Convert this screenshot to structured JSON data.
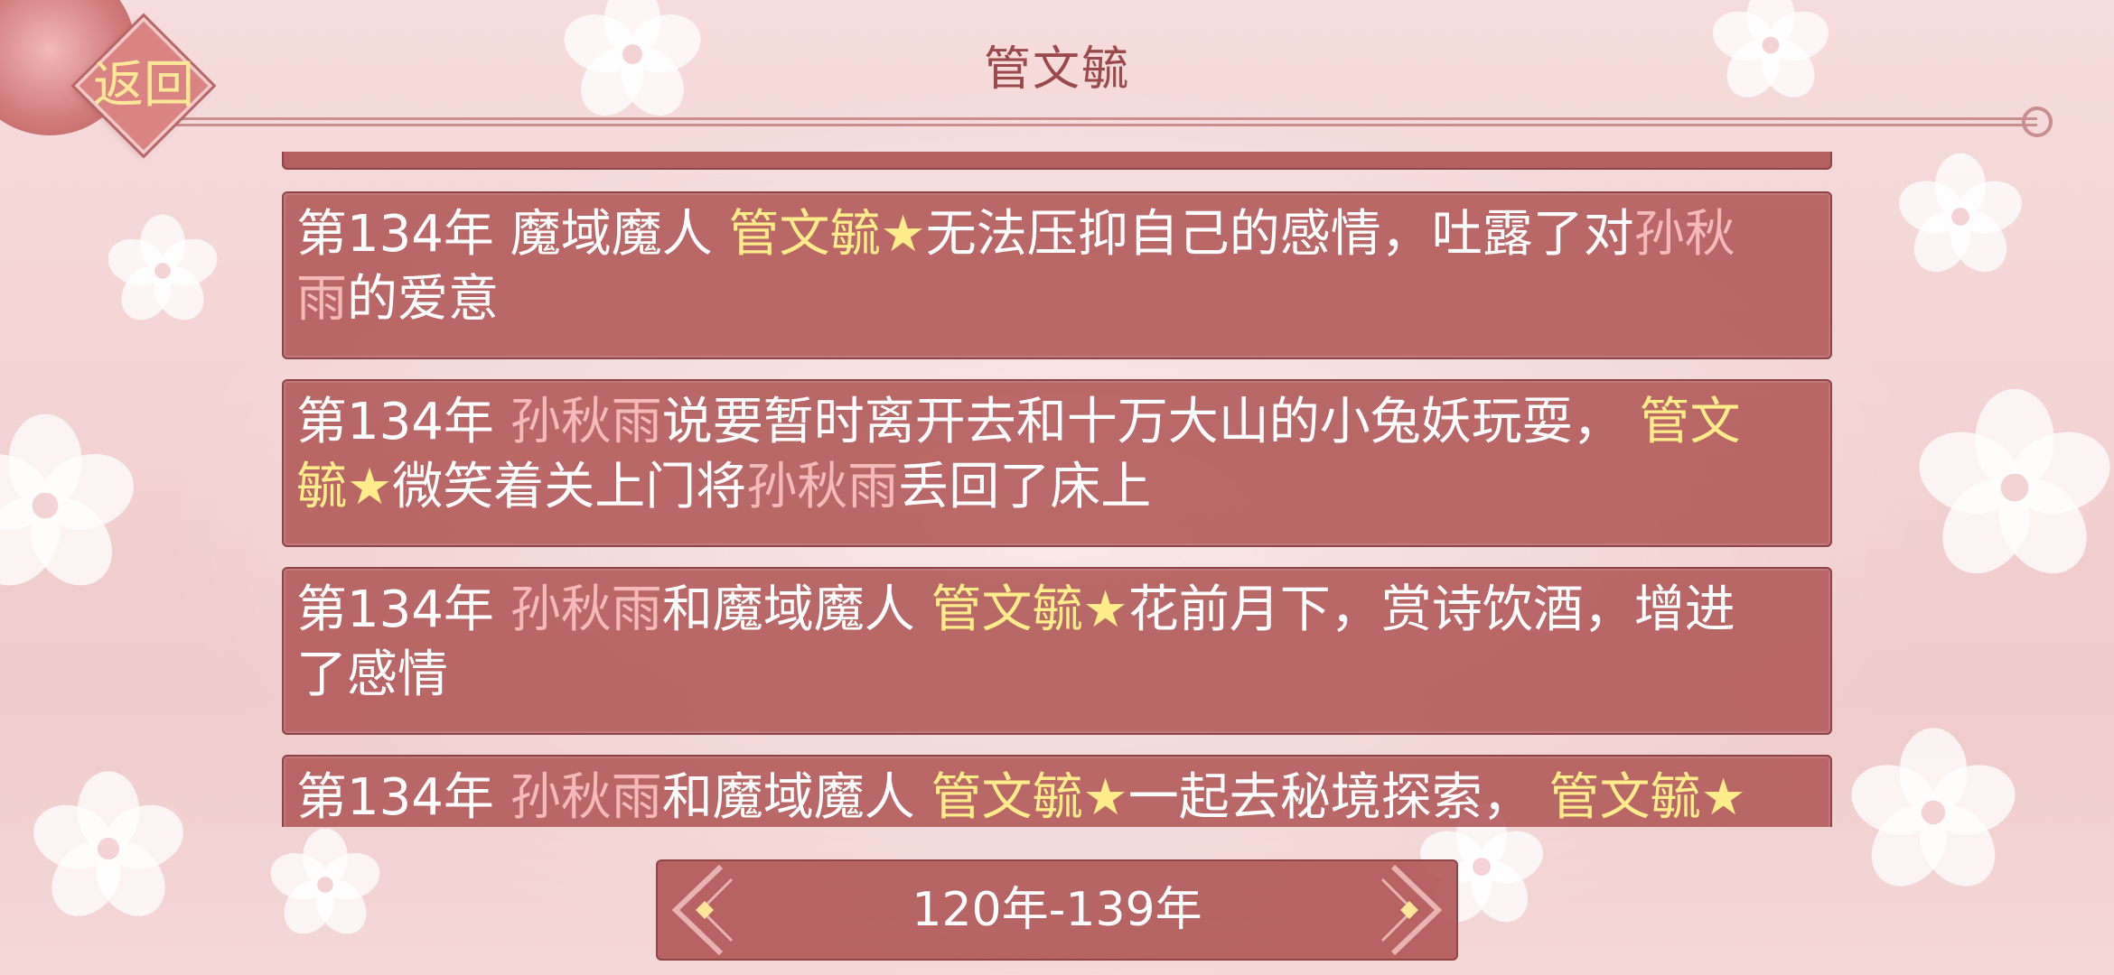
{
  "header": {
    "title": "管文毓",
    "back_label": "返回"
  },
  "icons": {
    "back": "back-button-diamond",
    "prev": "chevron-left-ornament-icon",
    "next": "chevron-right-ornament-icon",
    "star": "★"
  },
  "colors": {
    "card_bg": "#b05656",
    "highlight_main": "#ffec8a",
    "highlight_other": "#f4b9b9",
    "title": "#9a4a4a"
  },
  "entries": [
    {
      "segments": [
        {
          "text": "第134年 魔域魔人 ",
          "style": "plain"
        },
        {
          "text": "管文毓★",
          "style": "main"
        },
        {
          "text": "无法压抑自己的感情，吐露了对",
          "style": "plain"
        },
        {
          "text": "孙秋雨",
          "style": "other"
        },
        {
          "text": "的爱意",
          "style": "plain"
        }
      ]
    },
    {
      "segments": [
        {
          "text": "第134年 ",
          "style": "plain"
        },
        {
          "text": "孙秋雨",
          "style": "other"
        },
        {
          "text": "说要暂时离开去和十万大山的小兔妖玩耍， ",
          "style": "plain"
        },
        {
          "text": "管文毓★",
          "style": "main"
        },
        {
          "text": "微笑着关上门将",
          "style": "plain"
        },
        {
          "text": "孙秋雨",
          "style": "other"
        },
        {
          "text": "丢回了床上",
          "style": "plain"
        }
      ]
    },
    {
      "segments": [
        {
          "text": "第134年 ",
          "style": "plain"
        },
        {
          "text": "孙秋雨",
          "style": "other"
        },
        {
          "text": "和魔域魔人 ",
          "style": "plain"
        },
        {
          "text": "管文毓★",
          "style": "main"
        },
        {
          "text": "花前月下，赏诗饮酒，增进了感情",
          "style": "plain"
        }
      ]
    },
    {
      "segments": [
        {
          "text": "第134年 ",
          "style": "plain"
        },
        {
          "text": "孙秋雨",
          "style": "other"
        },
        {
          "text": "和魔域魔人 ",
          "style": "plain"
        },
        {
          "text": "管文毓★",
          "style": "main"
        },
        {
          "text": "一起去秘境探索， ",
          "style": "plain"
        },
        {
          "text": "管文毓★",
          "style": "main"
        }
      ]
    }
  ],
  "pager": {
    "label": "120年-139年"
  }
}
